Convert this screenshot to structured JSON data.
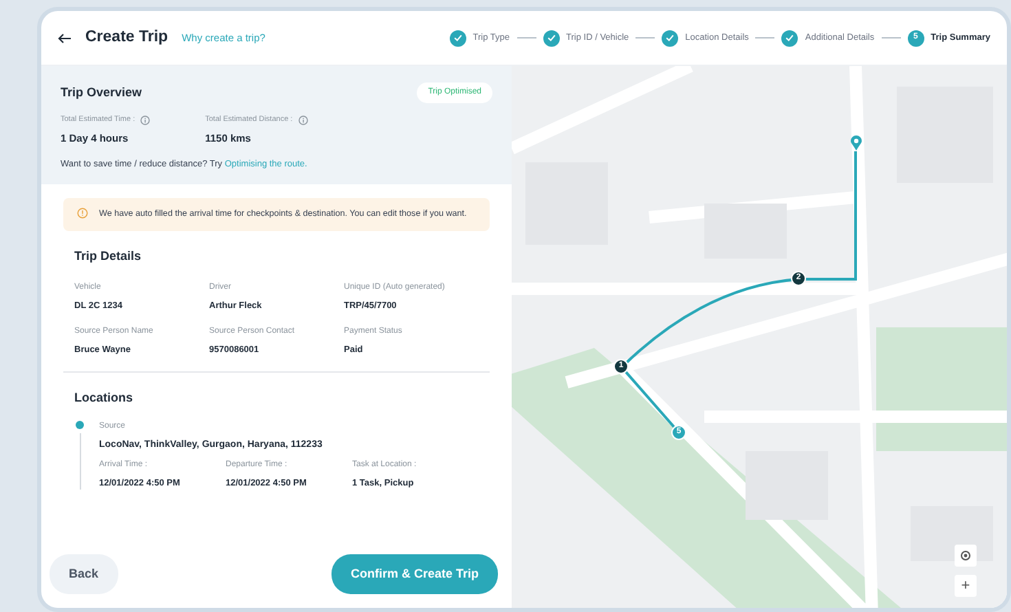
{
  "header": {
    "title": "Create Trip",
    "help_link": "Why create a trip?"
  },
  "steps": [
    {
      "label": "Trip Type",
      "completed": true,
      "current": false
    },
    {
      "label": "Trip ID / Vehicle",
      "completed": true,
      "current": false
    },
    {
      "label": "Location Details",
      "completed": true,
      "current": false
    },
    {
      "label": "Additional Details",
      "completed": true,
      "current": false
    },
    {
      "label": "Trip Summary",
      "completed": false,
      "current": true,
      "number": "5"
    }
  ],
  "overview": {
    "title": "Trip Overview",
    "badge": "Trip Optimised",
    "stats": [
      {
        "label": "Total Estimated Time :",
        "value": "1 Day 4 hours"
      },
      {
        "label": "Total Estimated Distance :",
        "value": "1150 kms"
      }
    ],
    "hint": "Want to save time / reduce distance? Try",
    "hint_link": "Optimising the route."
  },
  "notice": "We have auto filled the arrival time for checkpoints & destination. You can edit those if you want.",
  "trip_details": {
    "title": "Trip Details",
    "fields": [
      {
        "label": "Vehicle",
        "value": "DL 2C 1234"
      },
      {
        "label": "Driver",
        "value": "Arthur Fleck"
      },
      {
        "label": "Unique ID (Auto generated)",
        "value": "TRP/45/7700"
      },
      {
        "label": "Source Person Name",
        "value": "Bruce Wayne"
      },
      {
        "label": "Source Person Contact",
        "value": "9570086001"
      },
      {
        "label": "Payment Status",
        "value": "Paid"
      }
    ]
  },
  "locations": {
    "title": "Locations",
    "items": [
      {
        "type": "Source",
        "address": "LocoNav, ThinkValley, Gurgaon, Haryana, 112233",
        "fields": [
          {
            "label": "Arrival Time :",
            "value": "12/01/2022 4:50 PM"
          },
          {
            "label": "Departure Time :",
            "value": "12/01/2022 4:50 PM"
          },
          {
            "label": "Task at Location :",
            "value": "1 Task, Pickup"
          }
        ]
      }
    ]
  },
  "buttons": {
    "back": "Back",
    "confirm": "Confirm & Create Trip"
  },
  "map": {
    "markers": [
      {
        "label": "2",
        "kind": "dark"
      },
      {
        "label": "1",
        "kind": "dark"
      },
      {
        "label": "5",
        "kind": "teal"
      }
    ],
    "zoom_in": "+"
  }
}
